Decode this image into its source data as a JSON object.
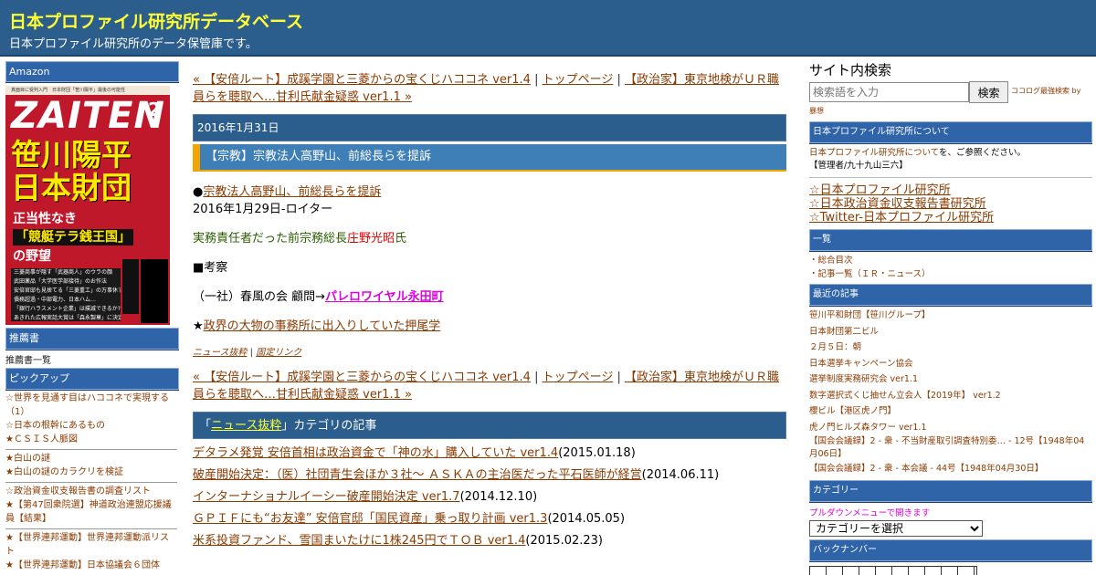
{
  "header": {
    "title": "日本プロファイル研究所データベース",
    "description": "日本プロファイル研究所のデータ保管庫です。"
  },
  "left": {
    "amazon_label": "Amazon",
    "magazine": {
      "top_text": "真面目に受判入門　日本財団「笹川陽平」最後の可能性",
      "logo": "ZAITEN",
      "issue": "2",
      "headline1": "笹川陽平",
      "headline2": "日本財団",
      "sub1": "正当性なき",
      "sub2": "「競艇テラ銭王国」",
      "sub3": "の野望",
      "stack_lines": [
        "三菱商事が隠す「武器商人」のウラの顔",
        "武田薬品「大学医学部接待」のお作法",
        "安倍官邸も見捨てる「三菱重工」の万事休す",
        "債務超過・中部電力、日本ハム…",
        "「銀行ハラスメント企業」は撲滅できるか?!",
        "あきれた広報実話大賞は「森永製菓」に決定!"
      ]
    },
    "recommend_label": "推薦書",
    "recommend_link": "推薦書一覧",
    "pickup_label": "ピックアップ",
    "pickup_groups": [
      [
        "☆世界を見通す目はハココネで実現する（1）",
        "☆日本の根幹にあるもの",
        "★ＣＳＩＳ人脈図"
      ],
      [
        "★白山の謎",
        "★白山の謎のカラクリを検証"
      ],
      [
        "☆政治資金収支報告書の調査リスト",
        "★【第47回衆院選】神道政治連盟応援議員【結果】"
      ],
      [
        "★【世界連邦運動】世界連邦運動派リスト",
        "★【世界連邦運動】日本協議会６団体"
      ]
    ]
  },
  "center": {
    "nav_prev": "« 【安倍ルート】成蹊学園と三菱からの宝くじハココネ ver1.4",
    "nav_sep1": " | ",
    "nav_top": "トップページ",
    "nav_sep2": " | ",
    "nav_next": "【政治家】東京地検がＵＲ職員らを聴取へ…甘利氏献金疑惑 ver1.1 »",
    "date": "2016年1月31日",
    "article_title": "【宗教】宗教法人高野山、前総長らを提訴",
    "bullet": "●",
    "article_link": "宗教法人高野山、前総長らを提訴",
    "article_source": "2016年1月29日-ロイター",
    "line_prefix": "実務責任者だった前宗務総長",
    "line_name": "庄野光昭",
    "line_suffix": "氏",
    "kousatsu": "■考察",
    "assoc_prefix": "（一社）春風の会 顧問→",
    "assoc_link": "パレロワイヤル永田町",
    "star": "★",
    "star_link": "政界の大物の事務所に出入りしていた押尾学",
    "foot_category": "ニュース抜粋",
    "foot_sep": " | ",
    "foot_permalink": "固定リンク",
    "category_bar_prefix": "「",
    "category_bar_link": "ニュース抜粋",
    "category_bar_suffix": "」カテゴリの記事",
    "related": [
      {
        "title": "デタラメ発覚 安倍首相は政治資金で「神の水」購入していた ver1.4",
        "date": "(2015.01.18)"
      },
      {
        "title": "破産開始決定：（医）社団青生会ほか３社～ ＡＳＫＡの主治医だった平石医師が経営",
        "date": "(2014.06.11)"
      },
      {
        "title": "インターナショナルイーシー破産開始決定 ver1.7",
        "date": "(2014.12.10)"
      },
      {
        "title": "ＧＰＩＦにも“お友達” 安倍官邸「国民資産」乗っ取り計画 ver1.3",
        "date": "(2014.05.05)"
      },
      {
        "title": "米系投資ファンド、雪国まいたけに1株245円でＴＯＢ ver1.4",
        "date": "(2015.02.23)"
      }
    ]
  },
  "right": {
    "search_heading": "サイト内検索",
    "search_placeholder": "検索語を入力",
    "search_button": "検索",
    "search_by": "ココログ最強検索 by",
    "search_by2": "暴想",
    "about_label": "日本プロファイル研究所について",
    "about_link": "日本プロファイル研究所について",
    "about_suffix": "を、ご参照ください。",
    "admin": "【管理者/九十九山三六】",
    "big_links": [
      "☆日本プロファイル研究所",
      "☆日本政治資金収支報告書研究所",
      "☆Twitter-日本プロファイル研究所"
    ],
    "list_label": "一覧",
    "list_items": [
      "・総合目次",
      "・記事一覧（ＩＲ・ニュース）"
    ],
    "recent_label": "最近の記事",
    "recent_items": [
      "笹川平和財団【笹川グループ】",
      "日本財団第二ビル",
      "２月５日：朝",
      "日本選挙キャンペーン協会",
      "選挙制度実務研究会 ver1.1",
      "数字選択式くじ抽せん立会人【2019年】 ver1.2",
      "櫻ビル【港区虎ノ門】",
      "虎ノ門ヒルズ森タワー ver1.1",
      "【国会会議録】2 - 衆 - 不当財産取引調査特別委… - 12号【1948年04",
      "月06日】",
      "【国会会議録】2 - 衆 - 本会議 - 44号【1948年04月30日】"
    ],
    "category_label": "カテゴリー",
    "category_note": "プルダウンメニューで開きます",
    "category_select": "カテゴリーを選択",
    "backnumber_label": "バックナンバー"
  }
}
